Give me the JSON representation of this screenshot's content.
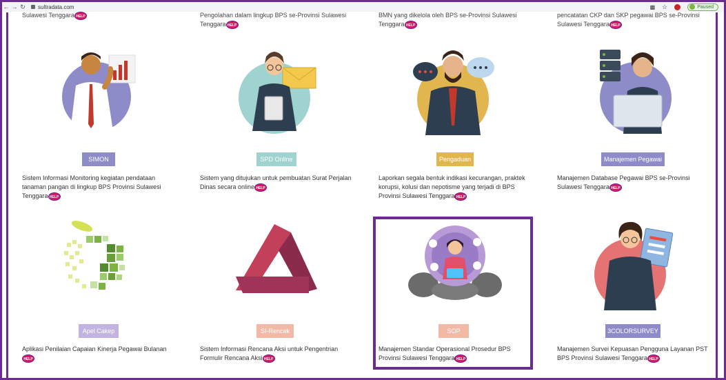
{
  "browser": {
    "url": "sultradata.com",
    "profile_status": "Paused"
  },
  "top_row": [
    "Sulawesi Tenggara",
    "Pengolahan dalam lingkup BPS se-Provinsi Sulawesi Tenggara",
    "BMN yang dikelola oleh BPS se-Provinsi Sulawesi Tenggara",
    "pencatatan CKP dan SKP pegawai BPS se-Provinsi Sulawesi Tenggara"
  ],
  "help_label": "HELP",
  "apps": [
    {
      "name": "SIMON",
      "color": "#8e8cc8",
      "desc": "Sistem Informasi Monitoring kegiatan pendataan tanaman pangan di lingkup BPS Provinsi Sulawesi Tenggara"
    },
    {
      "name": "SPD Online",
      "color": "#9fd3cf",
      "desc": "Sistem yang ditujukan untuk pembuatan Surat Perjalan Dinas secara online"
    },
    {
      "name": "Pengaduan",
      "color": "#e2b64f",
      "desc": "Laporkan segala bentuk indikasi kecurangan, praktek korupsi, kolusi dan nepotisme yang terjadi di BPS Provinsi Sulawesi Tenggara"
    },
    {
      "name": "Manajemen Pegawai",
      "color": "#8e8cc8",
      "desc": "Manajemen Database Pegawai BPS se-Provinsi Sulawesi Tenggara"
    },
    {
      "name": "Apel Cakep",
      "color": "#c3b3e0",
      "desc": "Aplikasi Penilaian Capaian Kinerja Pegawai Bulanan"
    },
    {
      "name": "SI-Rencak",
      "color": "#f1b9a6",
      "desc": "Sistem Informasi Rencana Aksi untuk Pengentrian Formulir Rencana Aksi"
    },
    {
      "name": "SOP",
      "color": "#f1b9a6",
      "desc": "Manajemen Standar Operasional Prosedur BPS Provinsi Sulawesi Tenggara"
    },
    {
      "name": "3COLORSURVEY",
      "color": "#8e8cc8",
      "desc": "Manajemen Survei Kepuasan Pengguna Layanan PST BPS Provinsi Sulawesi Tenggara"
    }
  ]
}
